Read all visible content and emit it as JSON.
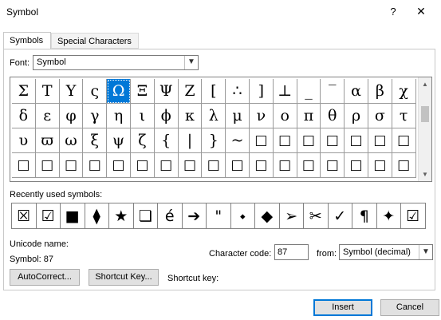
{
  "window": {
    "title": "Symbol",
    "help": "?",
    "close": "✕"
  },
  "tabs": [
    {
      "label": "Symbols",
      "active": true
    },
    {
      "label": "Special Characters",
      "active": false
    }
  ],
  "font": {
    "label": "Font:",
    "value": "Symbol"
  },
  "grid": {
    "rows": [
      [
        "Σ",
        "Τ",
        "Υ",
        "ς",
        "Ω",
        "Ξ",
        "Ψ",
        "Ζ",
        "[",
        "∴",
        "]",
        "⊥",
        "_",
        "‾",
        "α",
        "β",
        "χ"
      ],
      [
        "δ",
        "ε",
        "φ",
        "γ",
        "η",
        "ι",
        "ϕ",
        "κ",
        "λ",
        "μ",
        "ν",
        "ο",
        "π",
        "θ",
        "ρ",
        "σ",
        "τ"
      ],
      [
        "υ",
        "ϖ",
        "ω",
        "ξ",
        "ψ",
        "ζ",
        "{",
        "|",
        "}",
        "~",
        "□",
        "□",
        "□",
        "□",
        "□",
        "□",
        "□"
      ],
      [
        "□",
        "□",
        "□",
        "□",
        "□",
        "□",
        "□",
        "□",
        "□",
        "□",
        "□",
        "□",
        "□",
        "□",
        "□",
        "□",
        "□"
      ]
    ],
    "selected": {
      "row": 0,
      "col": 4
    }
  },
  "recent": {
    "label": "Recently used symbols:",
    "symbols": [
      "☒",
      "☑",
      "■",
      "⧫",
      "★",
      "❏",
      "é",
      "➔",
      "\"",
      "⬩",
      "◆",
      "➢",
      "✂",
      "✓",
      "¶",
      "✦",
      "☑"
    ]
  },
  "unicode": {
    "name_label": "Unicode name:",
    "value": "Symbol: 87"
  },
  "character_code": {
    "label": "Character code:",
    "value": "87"
  },
  "from": {
    "label": "from:",
    "value": "Symbol (decimal)"
  },
  "buttons": {
    "autocorrect": "AutoCorrect...",
    "shortcut_key": "Shortcut Key...",
    "shortcut_key_label": "Shortcut key:",
    "insert": "Insert",
    "cancel": "Cancel"
  }
}
